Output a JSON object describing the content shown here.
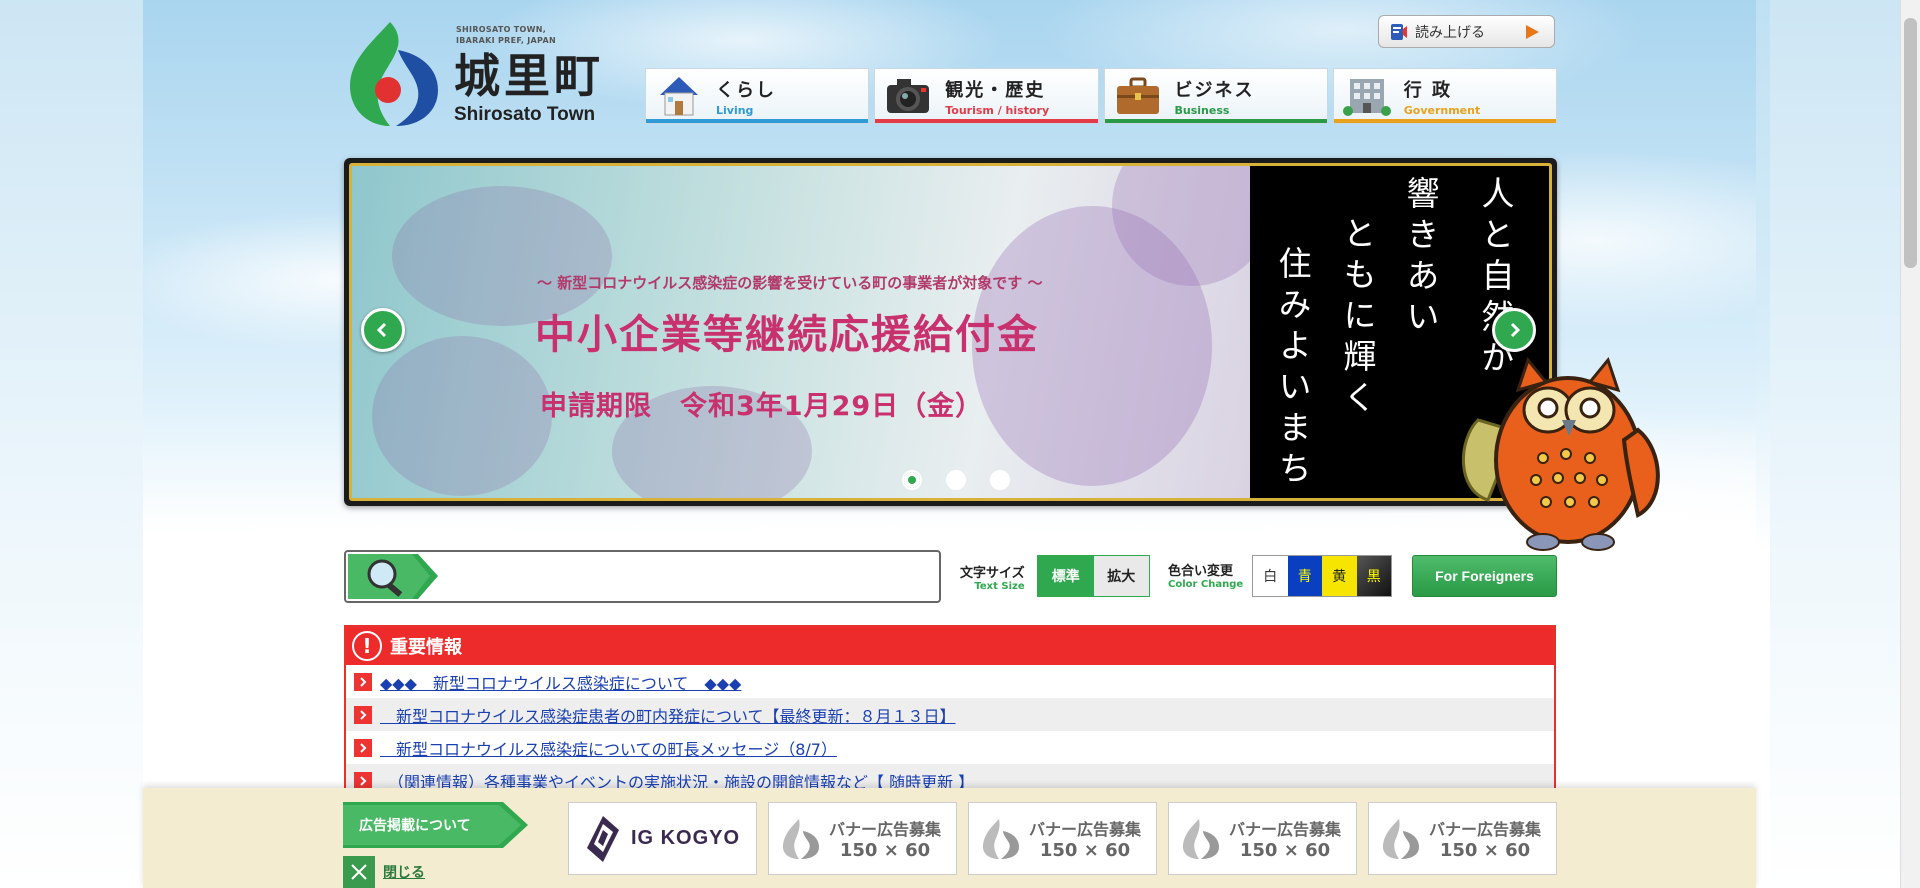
{
  "header": {
    "logo": {
      "tagline_line1": "SHIROSATO TOWN,",
      "tagline_line2": "IBARAKI PREF, JAPAN",
      "name_kanji": "城里町",
      "name_roman": "Shirosato Town"
    },
    "read_aloud_label": "読み上げる"
  },
  "nav": [
    {
      "jp": "くらし",
      "en": "Living",
      "color": "#2e9bd6"
    },
    {
      "jp": "観光・歴史",
      "en": "Tourism / history",
      "color": "#e23b4a"
    },
    {
      "jp": "ビジネス",
      "en": "Business",
      "color": "#2a9a47"
    },
    {
      "jp": "行 政",
      "en": "Government",
      "color": "#e8a21d"
    }
  ],
  "slider": {
    "subtitle": "～ 新型コロナウイルス感染症の影響を受けている町の事業者が対象です ～",
    "title": "中小企業等継続応援給付金",
    "deadline": "申請期限　令和3年1月29日（金）",
    "copy_col1": "人と自然が",
    "copy_col2": "響きあい",
    "copy_col3": "ともに輝く",
    "copy_col4": "住みよいまち",
    "dots": 3,
    "active_dot": 0
  },
  "tools": {
    "text_size_label": "文字サイズ",
    "text_size_label_en": "Text Size",
    "text_size_standard": "標準",
    "text_size_large": "拡大",
    "color_label": "色合い変更",
    "color_label_en": "Color Change",
    "color_white": "白",
    "color_blue": "青",
    "color_yellow": "黄",
    "color_black": "黒",
    "foreigners": "For Foreigners",
    "search_placeholder": ""
  },
  "important": {
    "heading": "重要情報",
    "items": [
      "◆◆◆　新型コロナウイルス感染症について　◆◆◆",
      "　新型コロナウイルス感染症患者の町内発症について【最終更新：８月１３日】",
      "　新型コロナウイルス感染症についての町長メッセージ（8/7）",
      "　（関連情報）各種事業やイベントの実施状況・施設の開館情報など【 随時更新 】"
    ]
  },
  "adbar": {
    "about_label": "広告掲載について",
    "close_label": "閉じる",
    "banners": [
      {
        "type": "brand",
        "text": "IG KOGYO"
      },
      {
        "type": "placeholder",
        "line1": "バナー広告募集",
        "line2": "150 × 60"
      },
      {
        "type": "placeholder",
        "line1": "バナー広告募集",
        "line2": "150 × 60"
      },
      {
        "type": "placeholder",
        "line1": "バナー広告募集",
        "line2": "150 × 60"
      },
      {
        "type": "placeholder",
        "line1": "バナー広告募集",
        "line2": "150 × 60"
      }
    ]
  },
  "colors": {
    "green": "#2fa84f",
    "red": "#ee2b2b",
    "link": "#1a3fb0"
  }
}
